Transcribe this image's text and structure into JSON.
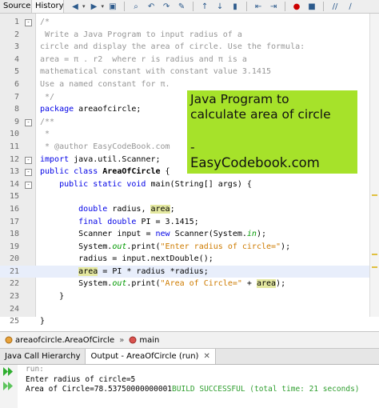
{
  "toolbar": {
    "tabs": [
      "Source",
      "History"
    ],
    "icons": [
      "go-back-icon",
      "dropdown-icon",
      "go-forward-icon",
      "dropdown-icon",
      "last-edit-icon",
      "find-selection-icon",
      "find-previous-icon",
      "find-next-icon",
      "toggle-highlight-icon",
      "toggle-rectangle-icon",
      "previous-bookmark-icon",
      "next-bookmark-icon",
      "toggle-bookmark-icon",
      "shift-left-icon",
      "shift-right-icon",
      "start-macro-icon",
      "stop-macro-icon",
      "comment-icon",
      "uncomment-icon"
    ]
  },
  "editor": {
    "lines": [
      {
        "n": "1",
        "text": "/*"
      },
      {
        "n": "2",
        "text": " Write a Java Program to input radius of a"
      },
      {
        "n": "3",
        "text": "circle and display the area of circle. Use the formula:"
      },
      {
        "n": "4",
        "text": "area = π . r2  where r is radius and π is a"
      },
      {
        "n": "5",
        "text": "mathematical constant with constant value 3.1415"
      },
      {
        "n": "6",
        "text": "Use a named constant for π."
      },
      {
        "n": "7",
        "text": " */"
      },
      {
        "n": "8",
        "kw": "package",
        "rest": " areaofcircle;"
      },
      {
        "n": "9",
        "text": "/**"
      },
      {
        "n": "10",
        "text": " *"
      },
      {
        "n": "11",
        "text": " * @author EasyCodeBook.com"
      },
      {
        "n": "12",
        "kw": "import",
        "rest": " java.util.Scanner;"
      },
      {
        "n": "13",
        "kw": "public class",
        "cls": " AreaOfCircle",
        "rest": " {"
      },
      {
        "n": "14",
        "kw": "    public static void",
        "rest": " main(String[] args) {"
      },
      {
        "n": "15",
        "text": ""
      },
      {
        "n": "16",
        "kw": "        double",
        "rest": " radius, ",
        "hlw": "area",
        "tail": ";"
      },
      {
        "n": "17",
        "kw": "        final double",
        "rest": " PI = 3.1415;"
      },
      {
        "n": "18",
        "pre": "        Scanner input = ",
        "kw": "new",
        "rest": " Scanner(System.",
        "fld": "in",
        "tail": ");"
      },
      {
        "n": "19",
        "pre": "        System.",
        "fld": "out",
        "rest": ".print(",
        "str": "\"Enter radius of circle=\"",
        "tail": ");"
      },
      {
        "n": "20",
        "text": "        radius = input.nextDouble();"
      },
      {
        "n": "21",
        "pre": "        ",
        "hlw": "area",
        "rest": " = PI * radius *radius;"
      },
      {
        "n": "22",
        "pre": "        System.",
        "fld": "out",
        "rest": ".print(",
        "str": "\"Area of Circle=\"",
        "mid": " + ",
        "hlw": "area",
        "tail": ");"
      },
      {
        "n": "23",
        "text": "    }"
      },
      {
        "n": "24",
        "text": ""
      },
      {
        "n": "25",
        "text": "}"
      }
    ]
  },
  "banner": {
    "line1": "Java Program to",
    "line2": "calculate area of circle",
    "line3": "-",
    "line4": "EasyCodebook.com",
    "color": "#a6e22a"
  },
  "breadcrumb": {
    "items": [
      "areaofcircle.AreaOfCircle",
      "main"
    ],
    "separator": "»"
  },
  "output": {
    "tabs": [
      "Java Call Hierarchy",
      "Output - AreaOfCircle (run)"
    ],
    "lines": [
      {
        "text": "run:",
        "style": "grey"
      },
      {
        "text": "Enter radius of circle=5",
        "style": "normal"
      },
      {
        "text": "Area of Circle=78.53750000000001",
        "style": "normal",
        "suffix": "BUILD SUCCESSFUL (total time: 21 seconds)"
      }
    ]
  },
  "colors": {
    "keyword": "#0000e6",
    "comment": "#969696",
    "string": "#ce7b00",
    "field": "#009900",
    "highlight": "#e4e8a0",
    "current_line": "#e8eefb",
    "build_success": "#2e9e2e"
  }
}
